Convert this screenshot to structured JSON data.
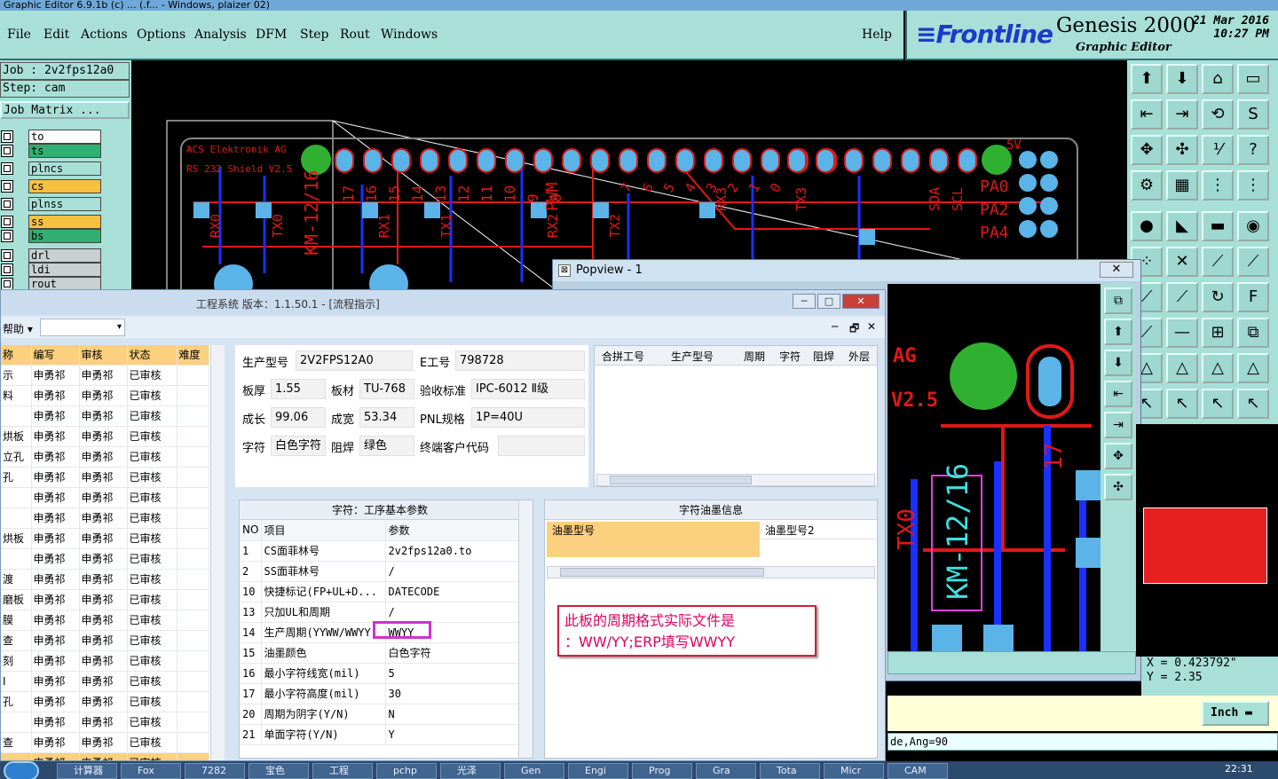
{
  "window_title": "Graphic Editor 6.9.1b (c) ... (.f... - Windows, plaizer 02)",
  "menu": [
    "File",
    "Edit",
    "Actions",
    "Options",
    "Analysis",
    "DFM",
    "Step",
    "Rout",
    "Windows"
  ],
  "menu_help": "Help",
  "logo": {
    "brand": "Frontline",
    "product": "Genesis 2000",
    "subtitle": "Graphic Editor",
    "date": "21 Mar 2016",
    "time": "10:27 PM"
  },
  "job": {
    "job": "Job : 2v2fps12a0",
    "step": "Step: cam",
    "matrix": "Job Matrix ..."
  },
  "layers": [
    {
      "name": "to",
      "color": "#ffffff"
    },
    {
      "name": "ts",
      "color": "#30b070"
    },
    {
      "name": "plncs",
      "color": "#a8e0d8"
    },
    {
      "name": "cs",
      "color": "#f8c040"
    },
    {
      "name": "plnss",
      "color": "#a8e0d8"
    },
    {
      "name": "ss",
      "color": "#f8c040"
    },
    {
      "name": "bs",
      "color": "#30b070"
    },
    {
      "name": "drl",
      "color": "#c8d0d0"
    },
    {
      "name": "ldi",
      "color": "#c8d0d0"
    },
    {
      "name": "rout",
      "color": "#c8d0d0"
    }
  ],
  "pcb": {
    "maker": "ACS Elektronik AG",
    "board": "RS 232 Shield V2.5",
    "voltage": "5V",
    "pins": [
      "17",
      "16",
      "15",
      "14",
      "13",
      "12",
      "11",
      "10",
      "9",
      "8"
    ],
    "pins2": [
      "7",
      "6",
      "5",
      "4",
      "3",
      "2",
      "1",
      "0"
    ],
    "sig": [
      "RX0",
      "TX0",
      "RX1",
      "TX1",
      "RX2",
      "TX2",
      "RX3",
      "TX3"
    ],
    "right": [
      "PA0",
      "PA2",
      "PA4"
    ],
    "pwm": "PWM",
    "km": "KM-12/16",
    "i2c": [
      "SDA",
      "SCL"
    ]
  },
  "popview": {
    "title": "Popview - 1",
    "ag": "AG",
    "ver": "V2.5",
    "km": "KM-12/16",
    "n17": "17",
    "tx0": "TX0"
  },
  "coords": {
    "x": "X = 0.423792\"",
    "y": "Y = 2.35"
  },
  "inch_label": "Inch",
  "status_line": "de,Ang=90",
  "erp": {
    "title": "工程系统  版本：1.1.50.1 - [流程指示]",
    "help": "帮助",
    "grid_headers": [
      "称",
      "编写",
      "审核",
      "状态",
      "难度"
    ],
    "grid_rows": [
      [
        "示",
        "申勇祁",
        "申勇祁",
        "已审核",
        ""
      ],
      [
        "料",
        "申勇祁",
        "申勇祁",
        "已审核",
        ""
      ],
      [
        "",
        "申勇祁",
        "申勇祁",
        "已审核",
        ""
      ],
      [
        "烘板",
        "申勇祁",
        "申勇祁",
        "已审核",
        ""
      ],
      [
        "立孔",
        "申勇祁",
        "申勇祁",
        "已审核",
        ""
      ],
      [
        "孔",
        "申勇祁",
        "申勇祁",
        "已审核",
        ""
      ],
      [
        "",
        "申勇祁",
        "申勇祁",
        "已审核",
        ""
      ],
      [
        "",
        "申勇祁",
        "申勇祁",
        "已审核",
        ""
      ],
      [
        "烘板",
        "申勇祁",
        "申勇祁",
        "已审核",
        ""
      ],
      [
        "",
        "申勇祁",
        "申勇祁",
        "已审核",
        ""
      ],
      [
        "渡",
        "申勇祁",
        "申勇祁",
        "已审核",
        ""
      ],
      [
        "磨板",
        "申勇祁",
        "申勇祁",
        "已审核",
        ""
      ],
      [
        "膜",
        "申勇祁",
        "申勇祁",
        "已审核",
        ""
      ],
      [
        "查",
        "申勇祁",
        "申勇祁",
        "已审核",
        ""
      ],
      [
        "刻",
        "申勇祁",
        "申勇祁",
        "已审核",
        ""
      ],
      [
        "I",
        "申勇祁",
        "申勇祁",
        "已审核",
        ""
      ],
      [
        "孔",
        "申勇祁",
        "申勇祁",
        "已审核",
        ""
      ],
      [
        "",
        "申勇祁",
        "申勇祁",
        "已审核",
        ""
      ],
      [
        "查",
        "申勇祁",
        "申勇祁",
        "已审核",
        ""
      ],
      [
        "",
        "申勇祁",
        "申勇祁",
        "已审核",
        ""
      ]
    ],
    "form": {
      "model_label": "生产型号",
      "model": "2V2FPS12A0",
      "eno_label": "E工号",
      "eno": "798728",
      "thick_label": "板厚",
      "thick": "1.55",
      "mat_label": "板材",
      "mat": "TU-768",
      "std_label": "验收标准",
      "std": "IPC-6012 Ⅱ级",
      "len_label": "成长",
      "len": "99.06",
      "wid_label": "成宽",
      "wid": "53.34",
      "pnl_label": "PNL规格",
      "pnl": "1P=40U",
      "char_label": "字符",
      "char": "白色字符",
      "mask_label": "阻焊",
      "mask": "绿色",
      "cust_label": "终端客户代码",
      "cust": ""
    },
    "merge_headers": [
      "合拼工号",
      "生产型号",
      "周期",
      "字符",
      "阻焊",
      "外层"
    ],
    "param_caption": "字符：工序基本参数",
    "param_headers": [
      "NO",
      "项目",
      "参数"
    ],
    "params": [
      [
        "1",
        "CS面菲林号",
        "2v2fps12a0.to"
      ],
      [
        "2",
        "SS面菲林号",
        "/"
      ],
      [
        "10",
        "快捷标记(FP+UL+D...",
        "DATECODE"
      ],
      [
        "13",
        "只加UL和周期",
        "/"
      ],
      [
        "14",
        "生产周期(YYWW/WWYY",
        "WWYY"
      ],
      [
        "15",
        "油墨颜色",
        "白色字符"
      ],
      [
        "16",
        "最小字符线宽(mil)",
        "5"
      ],
      [
        "17",
        "最小字符高度(mil)",
        "30"
      ],
      [
        "20",
        "周期为阴字(Y/N)",
        "N"
      ],
      [
        "21",
        "单面字符(Y/N)",
        "Y"
      ]
    ],
    "ink_caption": "字符油墨信息",
    "ink_headers": [
      "油墨型号",
      "油墨型号2"
    ],
    "note_line1": "此板的周期格式实际文件是",
    "note_line2": "：WW/YY;ERP填写WWYY"
  },
  "taskbar": [
    "计算器",
    "Fox",
    "7282",
    "宝色",
    "工程",
    "pchp",
    "光泽",
    "Gen",
    "Engi",
    "Prog",
    "Gra",
    "Tota",
    "Micr",
    "CAM"
  ],
  "clock": "22:31"
}
